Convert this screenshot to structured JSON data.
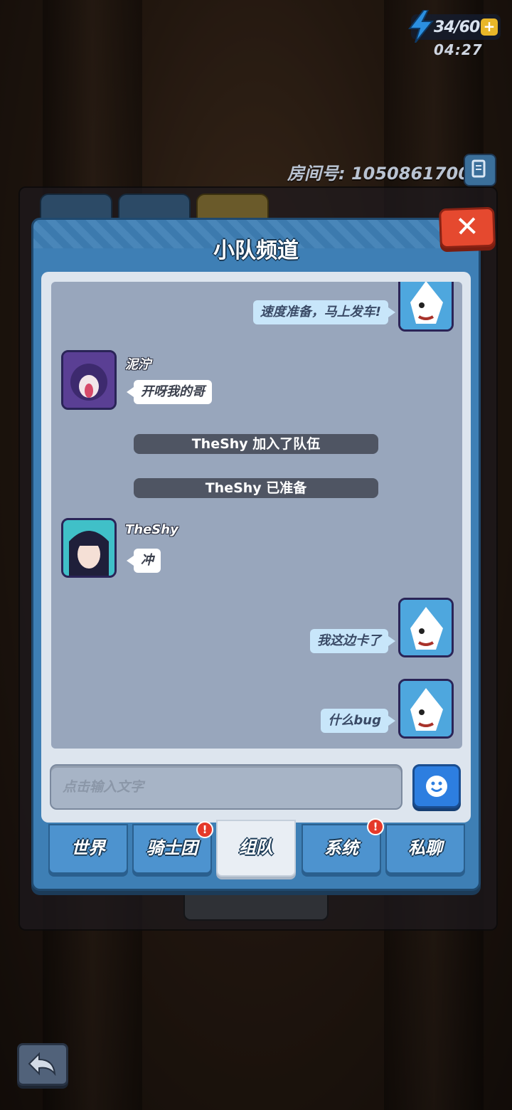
{
  "hud": {
    "energy_text": "34/60",
    "energy_plus": "+",
    "timer": "04:27"
  },
  "room": {
    "label": "房间号: 1050861700"
  },
  "dialog": {
    "title": "小队频道",
    "close_label": "✕"
  },
  "messages": [
    {
      "type": "self",
      "text": "速度准备，马上发车!"
    },
    {
      "type": "other",
      "username": "泥泞",
      "text": "开呀我的哥"
    },
    {
      "type": "system",
      "text": "TheShy 加入了队伍"
    },
    {
      "type": "system",
      "text": "TheShy 已准备"
    },
    {
      "type": "other",
      "username": "TheShy",
      "text": "冲"
    },
    {
      "type": "self",
      "text": "我这边卡了"
    },
    {
      "type": "self",
      "text": "什么bug"
    }
  ],
  "input": {
    "placeholder": "点击输入文字"
  },
  "tabs": [
    {
      "label": "世界",
      "active": false,
      "alert": ""
    },
    {
      "label": "骑士团",
      "active": false,
      "alert": "!"
    },
    {
      "label": "组队",
      "active": true,
      "alert": ""
    },
    {
      "label": "系统",
      "active": false,
      "alert": "!"
    },
    {
      "label": "私聊",
      "active": false,
      "alert": ""
    }
  ],
  "colors": {
    "dialog_blue": "#3e7fb5",
    "chat_bg": "#98a6bc",
    "self_bubble": "#c8e6fa",
    "system_bar": "#4f5563",
    "close_red": "#e5492f",
    "emoji_blue": "#2d7ee0"
  },
  "icons": [
    "energy-bolt-icon",
    "plus-icon",
    "copy-icon",
    "close-icon",
    "emoji-icon",
    "back-arrow-icon"
  ]
}
